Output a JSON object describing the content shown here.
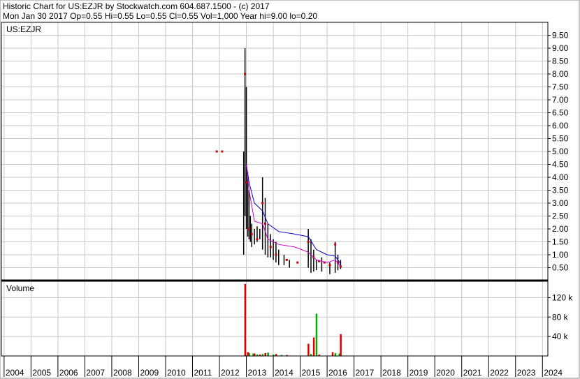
{
  "header": {
    "line1": "Historic Chart for US:EZJR by Stockwatch.com 604.687.1500 - (c) 2017",
    "line2": "Mon Jan 30 2017  Op=0.55  Hi=0.55  Lo=0.55  Cl=0.55  Vol=1,000  Year hi=9.00  lo=0.20"
  },
  "colors": {
    "grid": "#c8c8c8",
    "price_bar": "#000000",
    "close_marker": "#cc0000",
    "ma_long": "#0000cc",
    "ma_short": "#cc00cc",
    "volume_up": "#00aa00",
    "volume_down": "#dd0000"
  },
  "chart_data": [
    {
      "type": "line",
      "title": "US:EZJR",
      "ylim": [
        0,
        10
      ],
      "y_ticks": [
        "0.50",
        "1.00",
        "1.50",
        "2.00",
        "2.50",
        "3.00",
        "3.50",
        "4.00",
        "4.50",
        "5.00",
        "5.50",
        "6.00",
        "6.50",
        "7.00",
        "7.50",
        "8.00",
        "8.50",
        "9.00",
        "9.50"
      ],
      "x_ticks": [
        "2004",
        "2005",
        "2006",
        "2007",
        "2008",
        "2009",
        "2010",
        "2011",
        "2012",
        "2013",
        "2014",
        "2015",
        "2016",
        "2017",
        "2018",
        "2019",
        "2020",
        "2021",
        "2022",
        "2023",
        "2024"
      ],
      "xlim": [
        2003.9,
        2024.2
      ],
      "series": [
        {
          "kind": "hilo",
          "x": [
            2012.9,
            2012.95,
            2013.0,
            2013.05,
            2013.1,
            2013.15,
            2013.2,
            2013.3,
            2013.4,
            2013.5,
            2013.6,
            2013.7,
            2013.8,
            2013.9,
            2014.0,
            2014.1,
            2014.2,
            2014.4,
            2014.6,
            2015.3,
            2015.4,
            2015.5,
            2015.6,
            2015.8,
            2016.1,
            2016.3,
            2016.4,
            2016.5
          ],
          "high": [
            5.0,
            9.0,
            7.5,
            4.2,
            3.5,
            2.5,
            2.2,
            2.0,
            2.1,
            2.0,
            4.0,
            3.2,
            2.2,
            1.8,
            1.6,
            1.5,
            1.2,
            1.0,
            0.8,
            2.0,
            1.6,
            1.2,
            0.8,
            0.9,
            0.7,
            1.5,
            1.0,
            0.8
          ],
          "low": [
            1.0,
            2.5,
            2.0,
            1.7,
            1.6,
            1.5,
            1.3,
            1.4,
            1.5,
            1.6,
            1.2,
            1.0,
            0.9,
            0.9,
            0.8,
            0.7,
            0.6,
            0.6,
            0.5,
            0.5,
            0.3,
            0.35,
            0.4,
            0.35,
            0.25,
            0.3,
            0.4,
            0.45
          ]
        },
        {
          "kind": "close",
          "x": [
            2011.9,
            2012.1,
            2012.95,
            2013.0,
            2013.1,
            2013.2,
            2013.4,
            2013.6,
            2013.7,
            2013.9,
            2014.1,
            2014.5,
            2014.9,
            2015.3,
            2015.5,
            2015.7,
            2015.9,
            2016.1,
            2016.3,
            2016.4,
            2016.5
          ],
          "y": [
            5.0,
            5.0,
            8.0,
            3.8,
            2.0,
            1.8,
            1.6,
            3.0,
            2.2,
            1.3,
            1.0,
            0.8,
            0.7,
            1.5,
            0.9,
            0.75,
            0.7,
            0.6,
            1.4,
            0.7,
            0.55
          ]
        },
        {
          "kind": "ma_long",
          "x": [
            2013.0,
            2013.1,
            2013.3,
            2013.6,
            2013.8,
            2014.2,
            2014.8,
            2015.3,
            2015.6,
            2016.0,
            2016.3,
            2016.5
          ],
          "y": [
            4.5,
            3.8,
            3.0,
            2.7,
            2.2,
            1.9,
            1.8,
            1.7,
            1.2,
            1.0,
            0.95,
            0.65
          ]
        },
        {
          "kind": "ma_short",
          "x": [
            2013.0,
            2013.1,
            2013.3,
            2013.6,
            2013.8,
            2014.2,
            2014.8,
            2015.3,
            2015.6,
            2016.0,
            2016.3,
            2016.5
          ],
          "y": [
            4.5,
            3.5,
            2.3,
            2.2,
            1.6,
            1.4,
            1.3,
            1.1,
            0.8,
            0.7,
            0.8,
            0.55
          ]
        }
      ]
    },
    {
      "type": "bar",
      "title": "Volume",
      "ylim": [
        0,
        155
      ],
      "y_ticks": [
        "40 k",
        "80 k",
        "120 k"
      ],
      "series": [
        {
          "name": "up",
          "x": [
            2013.1,
            2013.25,
            2013.4,
            2013.6,
            2013.8,
            2014.0,
            2014.3,
            2015.4,
            2015.6,
            2016.3,
            2016.45
          ],
          "values": [
            6,
            5,
            3,
            4,
            7,
            3,
            2,
            4,
            87,
            6,
            5
          ]
        },
        {
          "name": "down",
          "x": [
            2012.95,
            2013.05,
            2013.3,
            2013.5,
            2013.7,
            2014.1,
            2014.5,
            2015.3,
            2015.5,
            2015.7,
            2016.2,
            2016.5
          ],
          "values": [
            148,
            8,
            5,
            3,
            6,
            4,
            2,
            25,
            38,
            3,
            8,
            45
          ]
        }
      ]
    }
  ]
}
